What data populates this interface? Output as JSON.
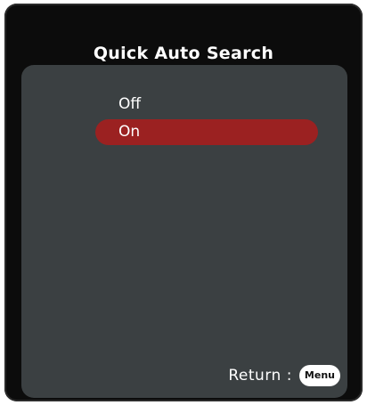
{
  "osd": {
    "title": "Quick Auto Search",
    "options": [
      {
        "label": "Off",
        "selected": false
      },
      {
        "label": "On",
        "selected": true
      }
    ],
    "return_label": "Return :",
    "menu_key_label": "Menu"
  },
  "colors": {
    "frame": "#0c0c0c",
    "panel": "#3b4042",
    "selection": "#9b2121",
    "text": "#ffffff"
  }
}
